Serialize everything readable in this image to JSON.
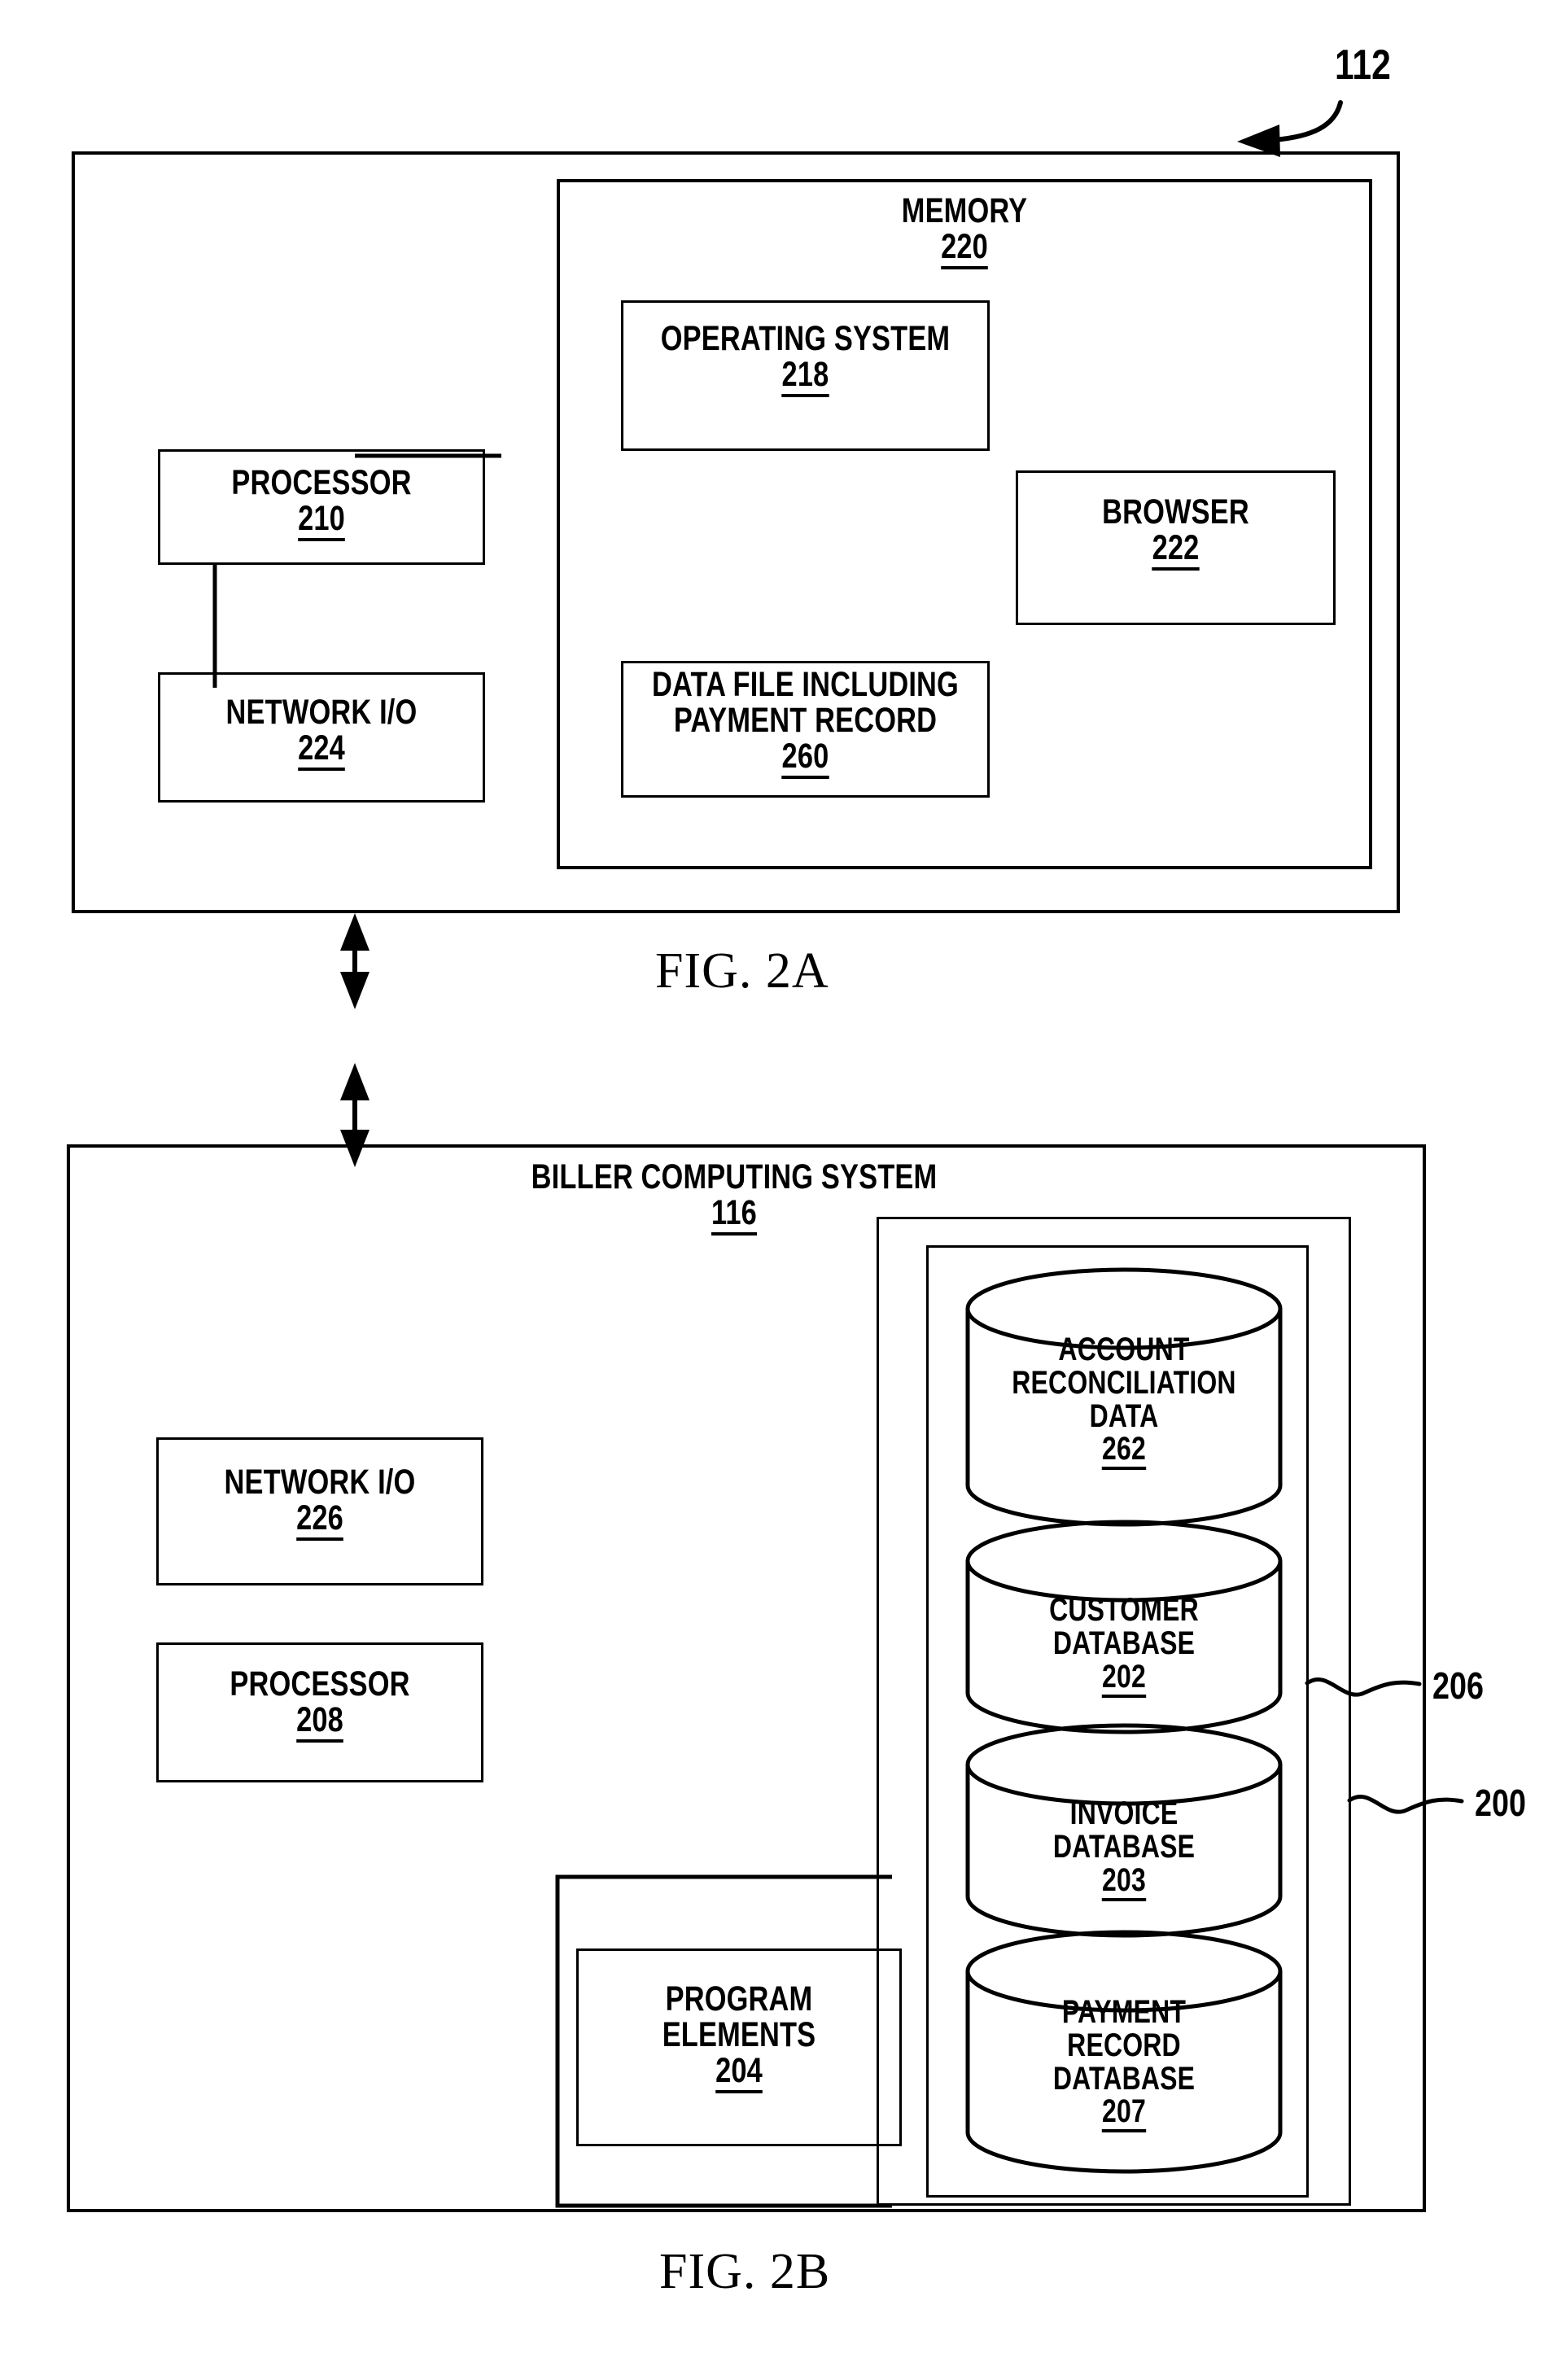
{
  "figure": {
    "sheet_callout": "112",
    "fig_a_caption": "FIG. 2A",
    "fig_b_caption": "FIG. 2B"
  },
  "fig2a": {
    "memory": {
      "label": "MEMORY",
      "ref": "220"
    },
    "operating_system": {
      "label": "OPERATING SYSTEM",
      "ref": "218"
    },
    "browser": {
      "label": "BROWSER",
      "ref": "222"
    },
    "data_file": {
      "line1": "DATA FILE INCLUDING",
      "line2": "PAYMENT RECORD",
      "ref": "260"
    },
    "processor": {
      "label": "PROCESSOR",
      "ref": "210"
    },
    "network_io": {
      "label": "NETWORK I/O",
      "ref": "224"
    }
  },
  "fig2b": {
    "title": {
      "label": "BILLER COMPUTING SYSTEM",
      "ref": "116"
    },
    "network_io": {
      "label": "NETWORK I/O",
      "ref": "226"
    },
    "processor": {
      "label": "PROCESSOR",
      "ref": "208"
    },
    "program_elements": {
      "line1": "PROGRAM",
      "line2": "ELEMENTS",
      "ref": "204"
    },
    "databases": [
      {
        "name": "account-reconciliation-data",
        "lines": [
          "ACCOUNT",
          "RECONCILIATION",
          "DATA"
        ],
        "ref": "262"
      },
      {
        "name": "customer-database",
        "lines": [
          "CUSTOMER",
          "DATABASE"
        ],
        "ref": "202"
      },
      {
        "name": "invoice-database",
        "lines": [
          "INVOICE",
          "DATABASE"
        ],
        "ref": "203"
      },
      {
        "name": "payment-record-database",
        "lines": [
          "PAYMENT",
          "RECORD",
          "DATABASE"
        ],
        "ref": "207"
      }
    ],
    "callout_inner": "206",
    "callout_outer": "200"
  },
  "colors": {
    "ink": "#000000",
    "paper": "#ffffff"
  }
}
